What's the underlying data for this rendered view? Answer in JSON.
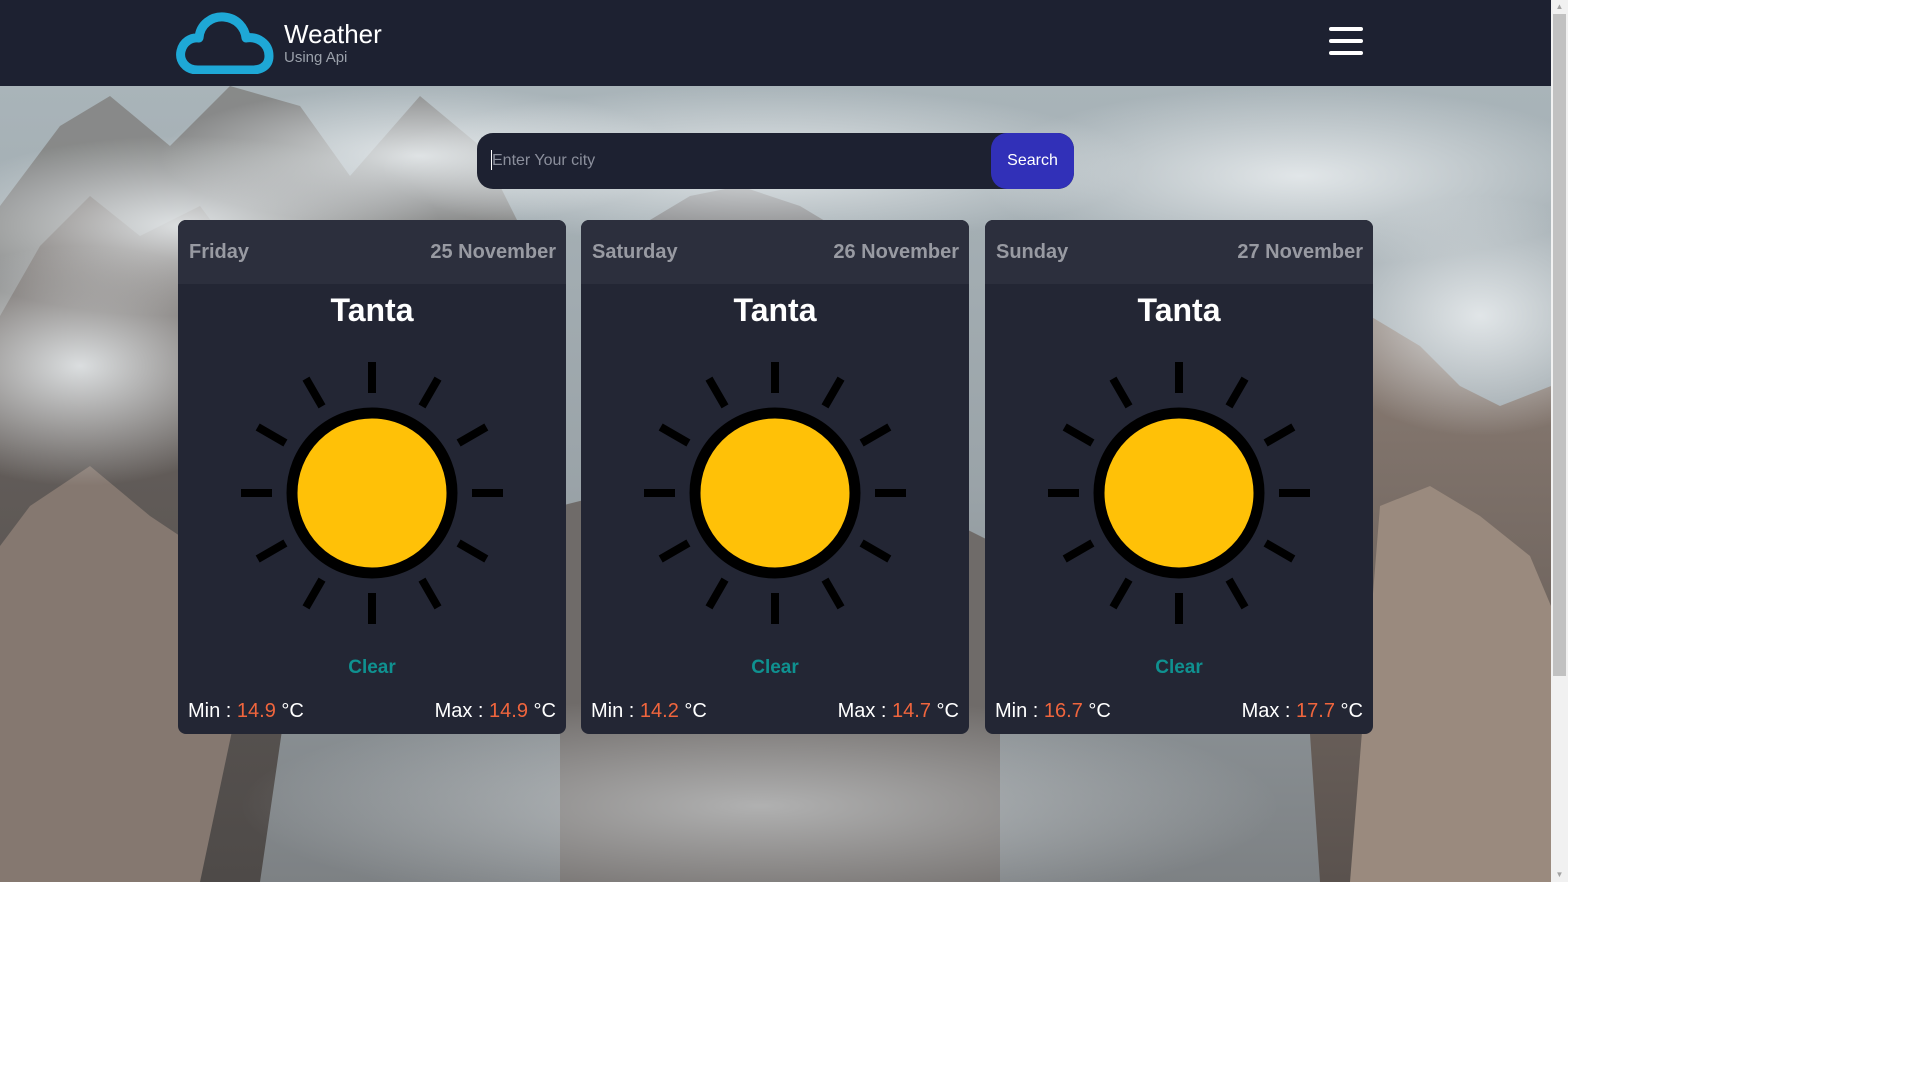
{
  "brand": {
    "title": "Weather",
    "subtitle": "Using Api",
    "logo_icon": "cloud-icon",
    "logo_color": "#1ea8d6"
  },
  "nav": {
    "menu_icon": "hamburger-menu-icon"
  },
  "search": {
    "placeholder": "Enter Your city",
    "value": "",
    "button_label": "Search",
    "button_color": "#3130b8"
  },
  "cards": [
    {
      "day": "Friday",
      "date": "25 November",
      "city": "Tanta",
      "icon": "sun-icon",
      "condition": "Clear",
      "min_label": "Min :",
      "min_value": "14.9",
      "max_label": "Max :",
      "max_value": "14.9",
      "unit": "°C"
    },
    {
      "day": "Saturday",
      "date": "26 November",
      "city": "Tanta",
      "icon": "sun-icon",
      "condition": "Clear",
      "min_label": "Min :",
      "min_value": "14.2",
      "max_label": "Max :",
      "max_value": "14.7",
      "unit": "°C"
    },
    {
      "day": "Sunday",
      "date": "27 November",
      "city": "Tanta",
      "icon": "sun-icon",
      "condition": "Clear",
      "min_label": "Min :",
      "min_value": "16.7",
      "max_label": "Max :",
      "max_value": "17.7",
      "unit": "°C"
    }
  ],
  "colors": {
    "navbar": "#1d2131",
    "card": "#232634",
    "card_header": "#2c2f3d",
    "condition": "#0f9190",
    "temperature": "#f0653d",
    "sun": "#ffc107"
  }
}
